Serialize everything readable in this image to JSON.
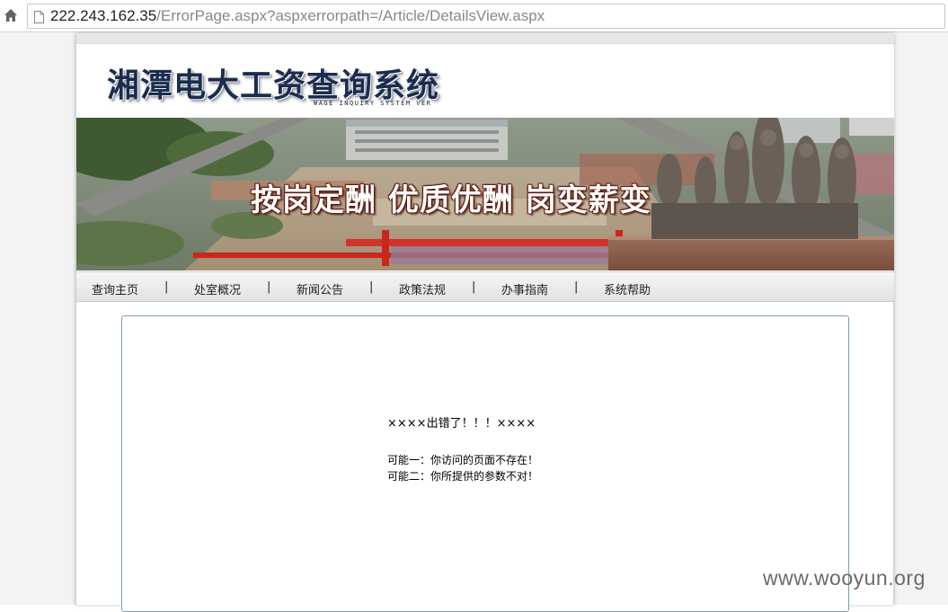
{
  "browser": {
    "url_host": "222.243.162.35",
    "url_path": "/ErrorPage.aspx?aspxerrorpath=/Article/DetailsView.aspx"
  },
  "site": {
    "title": "湘潭电大工资查询系统",
    "subtitle": "WAGE INQUIRY SYSTEM VER",
    "banner_slogan": "按岗定酬 优质优酬 岗变薪变"
  },
  "nav": {
    "items": [
      {
        "label": "查询主页"
      },
      {
        "label": "处室概况"
      },
      {
        "label": "新闻公告"
      },
      {
        "label": "政策法规"
      },
      {
        "label": "办事指南"
      },
      {
        "label": "系统帮助"
      }
    ],
    "separator": "|"
  },
  "error": {
    "title": "××××出错了！！！××××",
    "lines": [
      "可能一：你访问的页面不存在！",
      "可能二：你所提供的参数不对！"
    ]
  },
  "watermark": "www.wooyun.org",
  "colors": {
    "logo_text": "#1b2d4e",
    "content_border": "#7c9cae"
  }
}
